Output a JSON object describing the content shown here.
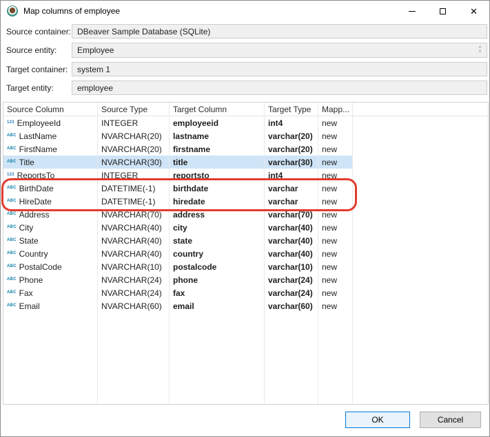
{
  "window": {
    "title": "Map columns of employee",
    "close_glyph": "✕"
  },
  "form": {
    "fields": [
      {
        "label": "Source container:",
        "value": "DBeaver Sample Database (SQLite)"
      },
      {
        "label": "Source entity:",
        "value": "Employee"
      },
      {
        "label": "Target container:",
        "value": "system 1"
      },
      {
        "label": "Target entity:",
        "value": "employee"
      }
    ]
  },
  "table": {
    "headers": [
      "Source Column",
      "Source Type",
      "Target Column",
      "Target Type",
      "Mapp..."
    ],
    "rows": [
      {
        "icon": "123",
        "source_column": "EmployeeId",
        "source_type": "INTEGER",
        "target_column": "employeeid",
        "target_type": "int4",
        "mapping": "new",
        "highlighted": false
      },
      {
        "icon": "ABC",
        "source_column": "LastName",
        "source_type": "NVARCHAR(20)",
        "target_column": "lastname",
        "target_type": "varchar(20)",
        "mapping": "new",
        "highlighted": false
      },
      {
        "icon": "ABC",
        "source_column": "FirstName",
        "source_type": "NVARCHAR(20)",
        "target_column": "firstname",
        "target_type": "varchar(20)",
        "mapping": "new",
        "highlighted": false
      },
      {
        "icon": "ABC",
        "source_column": "Title",
        "source_type": "NVARCHAR(30)",
        "target_column": "title",
        "target_type": "varchar(30)",
        "mapping": "new",
        "highlighted": true
      },
      {
        "icon": "123",
        "source_column": "ReportsTo",
        "source_type": "INTEGER",
        "target_column": "reportsto",
        "target_type": "int4",
        "mapping": "new",
        "highlighted": false
      },
      {
        "icon": "ABC",
        "source_column": "BirthDate",
        "source_type": "DATETIME(-1)",
        "target_column": "birthdate",
        "target_type": "varchar",
        "mapping": "new",
        "highlighted": false
      },
      {
        "icon": "ABC",
        "source_column": "HireDate",
        "source_type": "DATETIME(-1)",
        "target_column": "hiredate",
        "target_type": "varchar",
        "mapping": "new",
        "highlighted": false
      },
      {
        "icon": "ABC",
        "source_column": "Address",
        "source_type": "NVARCHAR(70)",
        "target_column": "address",
        "target_type": "varchar(70)",
        "mapping": "new",
        "highlighted": false
      },
      {
        "icon": "ABC",
        "source_column": "City",
        "source_type": "NVARCHAR(40)",
        "target_column": "city",
        "target_type": "varchar(40)",
        "mapping": "new",
        "highlighted": false
      },
      {
        "icon": "ABC",
        "source_column": "State",
        "source_type": "NVARCHAR(40)",
        "target_column": "state",
        "target_type": "varchar(40)",
        "mapping": "new",
        "highlighted": false
      },
      {
        "icon": "ABC",
        "source_column": "Country",
        "source_type": "NVARCHAR(40)",
        "target_column": "country",
        "target_type": "varchar(40)",
        "mapping": "new",
        "highlighted": false
      },
      {
        "icon": "ABC",
        "source_column": "PostalCode",
        "source_type": "NVARCHAR(10)",
        "target_column": "postalcode",
        "target_type": "varchar(10)",
        "mapping": "new",
        "highlighted": false
      },
      {
        "icon": "ABC",
        "source_column": "Phone",
        "source_type": "NVARCHAR(24)",
        "target_column": "phone",
        "target_type": "varchar(24)",
        "mapping": "new",
        "highlighted": false
      },
      {
        "icon": "ABC",
        "source_column": "Fax",
        "source_type": "NVARCHAR(24)",
        "target_column": "fax",
        "target_type": "varchar(24)",
        "mapping": "new",
        "highlighted": false
      },
      {
        "icon": "ABC",
        "source_column": "Email",
        "source_type": "NVARCHAR(60)",
        "target_column": "email",
        "target_type": "varchar(60)",
        "mapping": "new",
        "highlighted": false
      }
    ]
  },
  "buttons": {
    "ok": "OK",
    "cancel": "Cancel"
  },
  "colors": {
    "row_highlight": "#cfe4f7",
    "annotation_red": "#e23b2e",
    "focus_accent": "#0078d7",
    "field_background": "#f0f0f0",
    "numeric_icon": "#2778be",
    "string_icon": "#0e7fa8"
  }
}
